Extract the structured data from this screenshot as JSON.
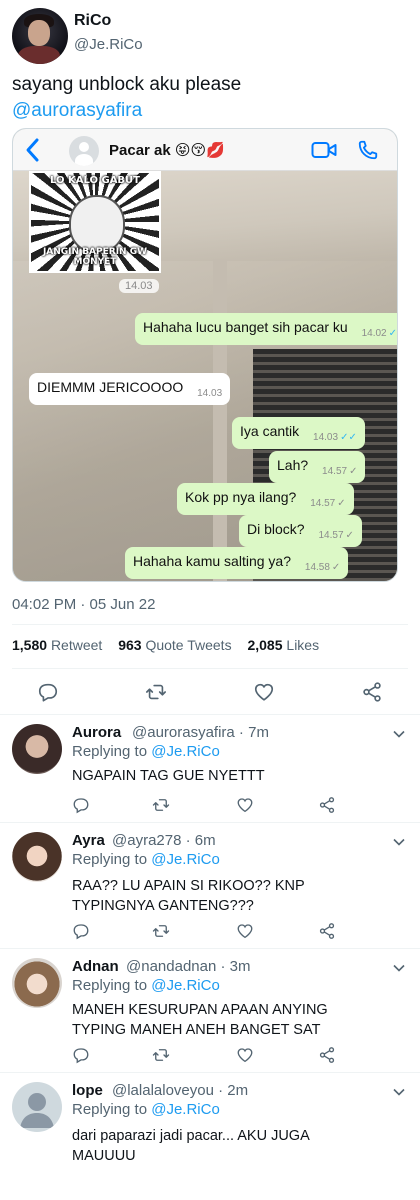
{
  "tweet": {
    "author_name": "RiCo",
    "author_handle": "@Je.RiCo",
    "text": "sayang unblock aku please",
    "mention": "@aurorasyafira",
    "timestamp": "04:02 PM · 05 Jun 22",
    "retweets": "1,580",
    "retweets_label": "Retweet",
    "quotes": "963",
    "quotes_label": "Quote Tweets",
    "likes": "2,085",
    "likes_label": "Likes"
  },
  "whatsapp": {
    "contact_name": "Pacar ak 😝😚💋",
    "meme_top": "LO KALO GABUT",
    "meme_bottom": "JANGIN BAPERIN GW MONYET",
    "meme_time": "14.03",
    "messages": [
      {
        "dir": "out",
        "text": "Hahaha lucu banget sih pacar ku",
        "time": "14.02",
        "read": true
      },
      {
        "dir": "in",
        "text": "DIEMMM JERICOOOO",
        "time": "14.03",
        "read": false
      },
      {
        "dir": "out",
        "text": "Iya cantik",
        "time": "14.03",
        "read": true
      },
      {
        "dir": "out",
        "text": "Lah?",
        "time": "14.57",
        "read": false
      },
      {
        "dir": "out",
        "text": "Kok pp nya ilang?",
        "time": "14.57",
        "read": false
      },
      {
        "dir": "out",
        "text": "Di block?",
        "time": "14.57",
        "read": false
      },
      {
        "dir": "out",
        "text": "Hahaha kamu salting ya?",
        "time": "14.58",
        "read": false
      }
    ]
  },
  "replies": [
    {
      "name": "Aurora",
      "handle": "@aurorasyafira · 7m",
      "replying_prefix": "Replying to",
      "replying_to": "@Je.RiCo",
      "text": "NGAPAIN TAG GUE NYETTT"
    },
    {
      "name": "Ayra",
      "handle": "@ayra278 · 6m",
      "replying_prefix": "Replying to",
      "replying_to": "@Je.RiCo",
      "text": "RAA?? LU APAIN SI RIKOO?? KNP TYPINGNYA GANTENG???"
    },
    {
      "name": "Adnan",
      "handle": "@nandadnan · 3m",
      "replying_prefix": "Replying to",
      "replying_to": "@Je.RiCo",
      "text": "MANEH KESURUPAN APAAN ANYING TYPING MANEH ANEH BANGET SAT"
    },
    {
      "name": "lope",
      "handle": "@lalalaloveyou · 2m",
      "replying_prefix": "Replying to",
      "replying_to": "@Je.RiCo",
      "text": "dari paparazi jadi pacar... AKU JUGA MAUUUU"
    }
  ],
  "colors": {
    "accent": "#1d9bf0",
    "wa_outgoing": "#dcf8c6",
    "wa_incoming": "#ffffff",
    "wa_read_check": "#34b7f1",
    "ios_blue": "#007aff"
  }
}
